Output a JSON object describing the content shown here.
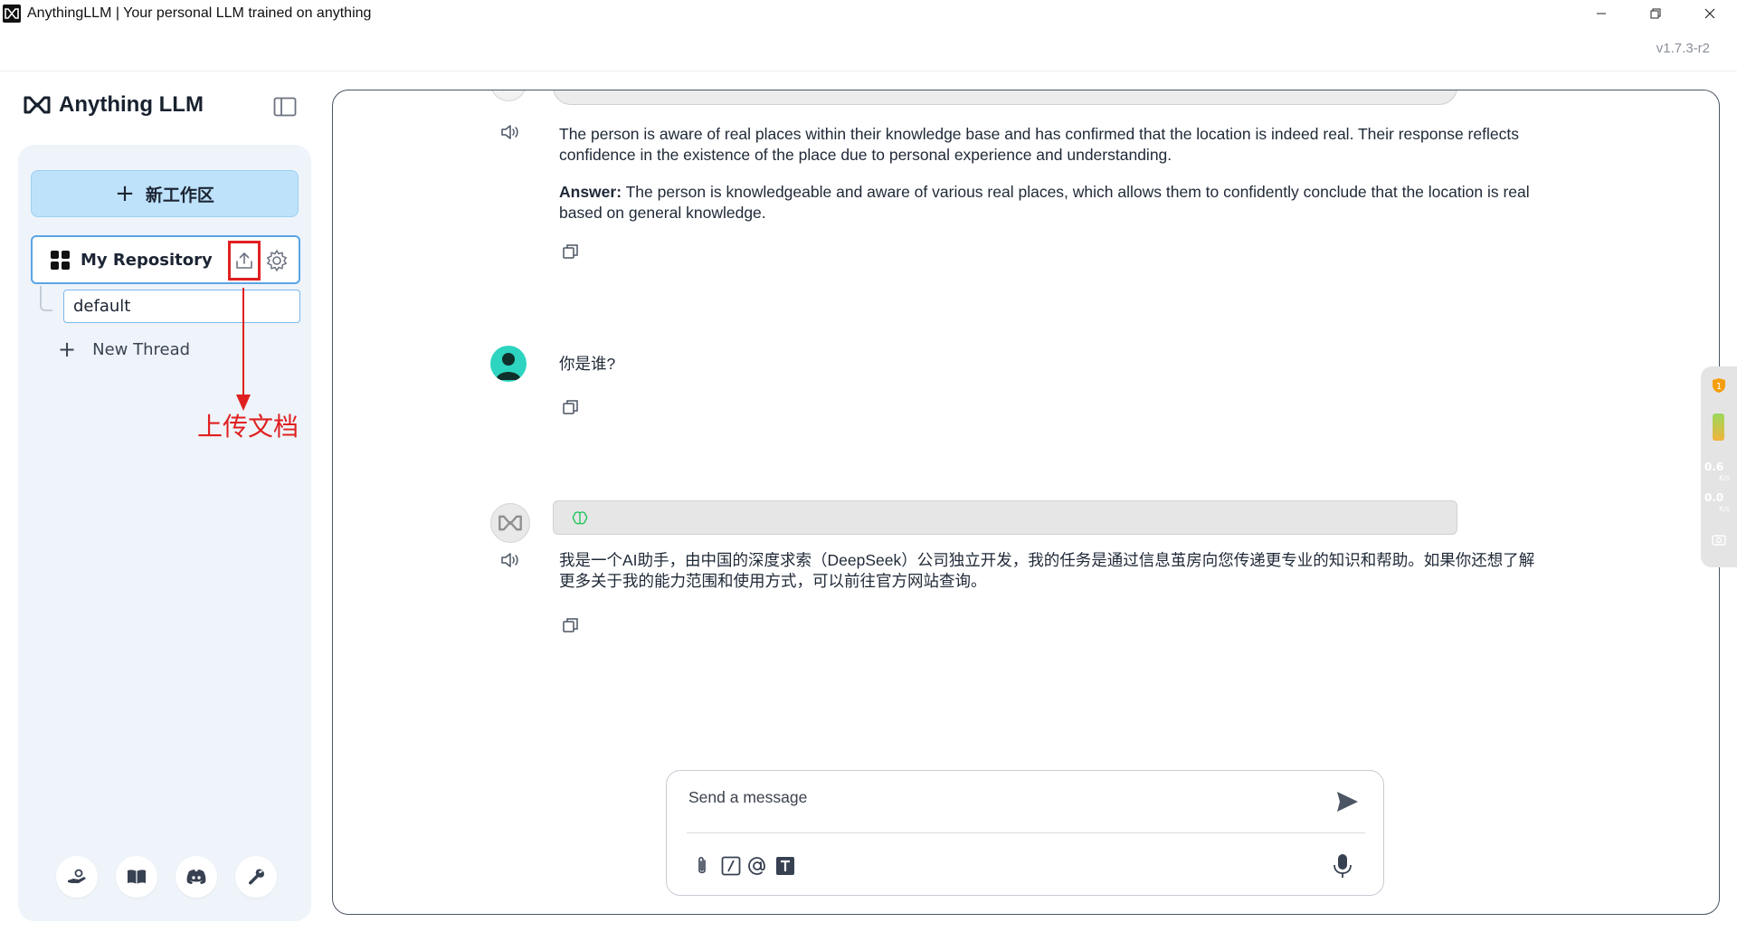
{
  "window": {
    "title": "AnythingLLM | Your personal LLM trained on anything",
    "version": "v1.7.3-r2",
    "controls": [
      "minimize-icon",
      "restore-icon",
      "close-icon"
    ]
  },
  "sidebar": {
    "brand": "Anything LLM",
    "new_workspace_label": "新工作区",
    "workspace": {
      "name": "My Repository",
      "upload_icon": "upload-icon",
      "settings_icon": "gear-icon"
    },
    "threads": [
      {
        "label": "default",
        "active": true
      }
    ],
    "new_thread_label": "New Thread",
    "annotation": {
      "text": "上传文档",
      "color": "#e02020"
    },
    "footer_icons": [
      "community-hub-icon",
      "docs-book-icon",
      "discord-icon",
      "wrench-icon"
    ]
  },
  "chat": {
    "messages": [
      {
        "role": "assistant",
        "paragraphs": [
          "The person is aware of real places within their knowledge base and has confirmed that the location is indeed real. Their response reflects confidence in the existence of the place due to personal experience and understanding."
        ],
        "answer_label": "Answer:",
        "answer_text": " The person is knowledgeable and aware of various real places, which allows them to confidently conclude that the location is real based on general knowledge."
      },
      {
        "role": "user",
        "text": "你是谁?"
      },
      {
        "role": "assistant",
        "text": "我是一个AI助手，由中国的深度求索（DeepSeek）公司独立开发，我的任务是通过信息茧房向您传递更专业的知识和帮助。如果你还想了解更多关于我的能力范围和使用方式，可以前往官方网站查询。"
      }
    ]
  },
  "composer": {
    "placeholder": "Send a message",
    "tools": [
      "paperclip-icon",
      "slash-command-icon",
      "at-mention-icon",
      "text-size-icon"
    ]
  },
  "widget": {
    "upload_speed": "0.6",
    "download_speed": "0.0",
    "unit": "K/s",
    "badge": "1"
  },
  "colors": {
    "accent_blue": "#5aa4e6",
    "new_workspace_bg": "#bfe2fb",
    "sidebar_bg": "#eef4fa",
    "annotation_red": "#e02020",
    "user_avatar": "#2dd4bf"
  }
}
